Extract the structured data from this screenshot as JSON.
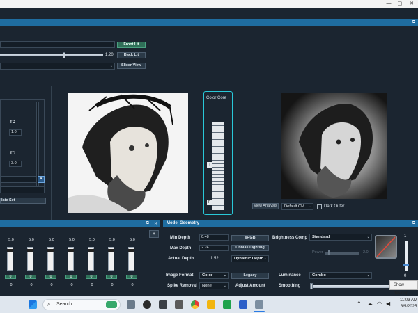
{
  "window": {
    "title": "",
    "controls": [
      "—",
      "▢",
      "✕"
    ]
  },
  "top": {
    "front_lit": "Front Lit",
    "back_lit": "Back Lit",
    "slicer_view": "Slicer View",
    "slider_value": "1.20",
    "slider_level": 0.62
  },
  "left_panel": {
    "td_label_1": "TD",
    "td_value_1": "1.0",
    "td_label_2": "TD",
    "td_value_2": "3.0",
    "button_label": "late Set"
  },
  "color_core": {
    "title": "Color Core",
    "marker": "T",
    "bottom_marker": "F"
  },
  "analysis": {
    "view_button": "View Analysis",
    "colormap": "Default CM",
    "dark_outer_label": "Dark Outer",
    "dark_outer_checked": false
  },
  "faders": {
    "values": [
      "5.0",
      "5.0",
      "5.0",
      "5.0",
      "5.0",
      "5.0",
      "5.0"
    ],
    "bottom_values": [
      "0",
      "0",
      "0",
      "0",
      "0",
      "0",
      "0"
    ],
    "levels": [
      0.95,
      0.95,
      0.95,
      0.95,
      0.95,
      0.95,
      0.95
    ]
  },
  "model_geometry": {
    "title": "Model Geometry",
    "min_depth_label": "Min Depth",
    "min_depth": "0.48",
    "max_depth_label": "Max Depth",
    "max_depth": "2.24",
    "actual_depth_label": "Actual Depth",
    "actual_depth": "1.52",
    "srgb_btn": "sRGB",
    "unbias_btn": "Unbias Lighting",
    "dynamic_depth": "Dynamic Depth",
    "brightness_label": "Brightness Comp",
    "brightness": "Standard",
    "power_text": "Power",
    "power_val": "2.0",
    "image_format_label": "Image Format",
    "image_format": "Color",
    "legacy_btn": "Legacy",
    "luminance_label": "Luminance",
    "luminance": "Combo",
    "spike_label": "Spike Removal",
    "spike": "None",
    "adjust_label": "Adjust Amount",
    "smoothing_label": "Smoothing",
    "right_top": "1",
    "right_bottom": "0"
  },
  "taskbar": {
    "search_placeholder": "Search",
    "time": "11:03 AM",
    "date": "3/5/2025",
    "tooltip": "Show desktop"
  }
}
